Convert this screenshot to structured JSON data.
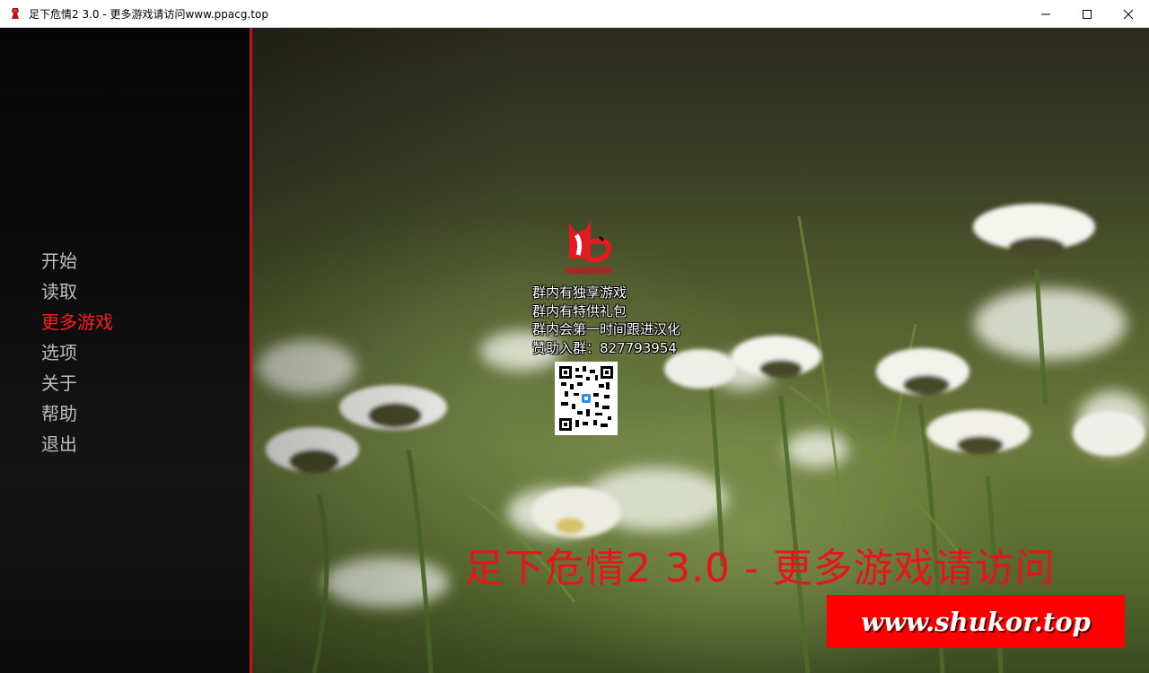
{
  "window": {
    "title": "足下危情2 3.0 - 更多游戏请访问www.ppacg.top",
    "icon": "app-icon",
    "controls": [
      "minimize-icon",
      "maximize-icon",
      "close-icon"
    ]
  },
  "menu": {
    "items": [
      {
        "label": "开始"
      },
      {
        "label": "读取"
      },
      {
        "label": "更多游戏"
      },
      {
        "label": "选项"
      },
      {
        "label": "关于"
      },
      {
        "label": "帮助"
      },
      {
        "label": "退出"
      }
    ],
    "active_index": 2,
    "active_color": "#ff1c1c"
  },
  "promo": {
    "lines": [
      "群内有独享游戏",
      "群内有特供礼包",
      "群内会第一时间跟进汉化",
      "赞助入群：827793954"
    ],
    "logo": "fox-logo-icon",
    "qr": "qr-code-icon"
  },
  "banner": {
    "title": "足下危情2 3.0 - 更多游戏请访问",
    "title_tail": "2",
    "watermark": "www.shukor.top",
    "accent": "#e8141a"
  }
}
